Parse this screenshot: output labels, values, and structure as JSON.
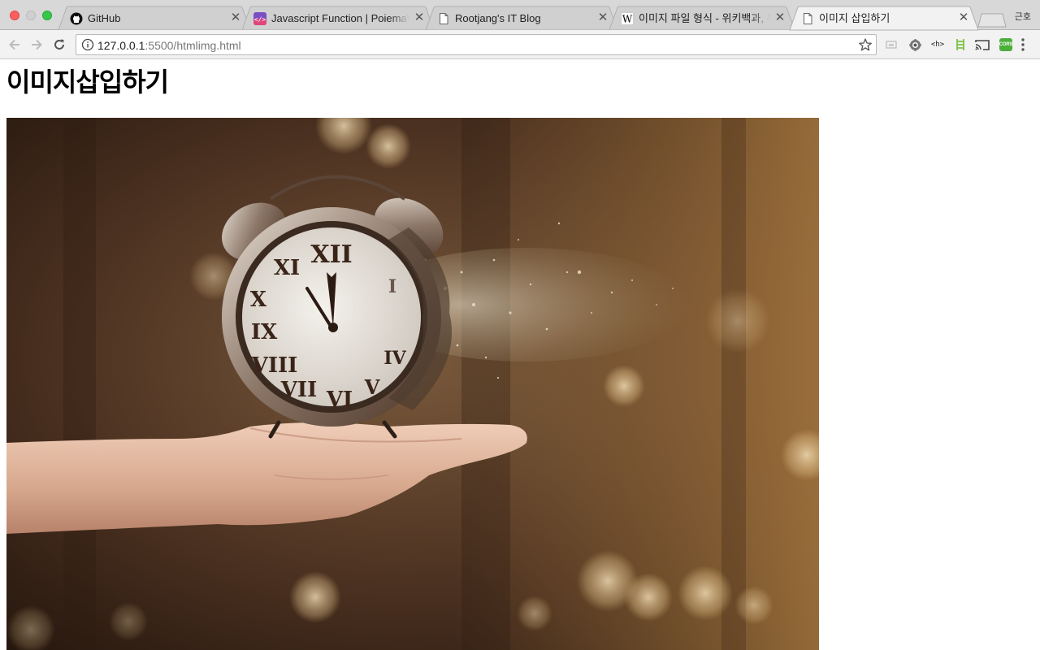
{
  "window": {
    "profile_name": "근호"
  },
  "tabs": [
    {
      "title": "GitHub",
      "icon": "github-icon",
      "active": false
    },
    {
      "title": "Javascript Function | PoiemaWeb",
      "icon": "poiemaweb-icon",
      "active": false
    },
    {
      "title": "Rootjang's IT Blog",
      "icon": "page-icon",
      "active": false
    },
    {
      "title": "이미지 파일 형식 - 위키백과, 우리 모두의 백과사전",
      "icon": "wikipedia-icon",
      "active": false
    },
    {
      "title": "이미지 삽입하기",
      "icon": "page-icon",
      "active": true
    }
  ],
  "toolbar": {
    "url_host": "127.0.0.1",
    "url_rest": ":5500/htmlimg.html",
    "extensions": [
      "cast-icon",
      "gear-extension-icon",
      "html-tag-icon",
      "ladder-extension-icon",
      "screen-cast-icon",
      "cors-extension-icon"
    ],
    "cors_label": "CORS"
  },
  "page": {
    "heading": "이미지삽입하기",
    "image_subject": "alarm-clock-disintegrating-over-hand"
  },
  "colors": {
    "tabstrip_bg": "#d8d8d8",
    "active_tab_bg": "#f2f2f2",
    "close_light": "#fc605c",
    "max_light": "#34c84a",
    "cors_green": "#4cae3b"
  }
}
